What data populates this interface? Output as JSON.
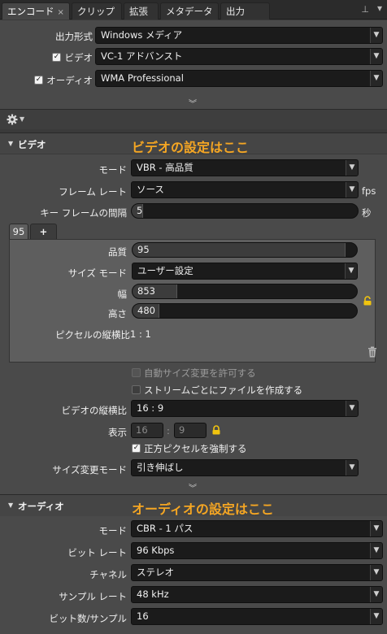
{
  "tabs": [
    {
      "label": "エンコード"
    },
    {
      "label": "クリップ"
    },
    {
      "label": "拡張"
    },
    {
      "label": "メタデータ"
    },
    {
      "label": "出力"
    }
  ],
  "tab_close": "×",
  "pin_glyph": "⊥",
  "menu_glyph": "▾",
  "output": {
    "format_label": "出力形式",
    "format_value": "Windows メディア",
    "video_label": "ビデオ",
    "video_value": "VC-1 アドバンスト",
    "video_checked": true,
    "audio_label": "オーディオ",
    "audio_value": "WMA Professional",
    "audio_checked": true
  },
  "video_section": {
    "title": "ビデオ",
    "annotation": "ビデオの設定はここ",
    "mode_label": "モード",
    "mode_value": "VBR - 高品質",
    "framerate_label": "フレーム レート",
    "framerate_value": "ソース",
    "framerate_unit": "fps",
    "keyframe_label": "キー フレームの間隔",
    "keyframe_value": "5",
    "keyframe_unit": "秒",
    "preset_tabs": [
      "95",
      "+"
    ],
    "quality_label": "品質",
    "quality_value": "95",
    "quality_level": 0.95,
    "size_mode_label": "サイズ モード",
    "size_mode_value": "ユーザー設定",
    "width_label": "幅",
    "width_value": "853",
    "width_level": 0.2,
    "height_label": "高さ",
    "height_value": "480",
    "height_level": 0.12,
    "pixel_aspect_label": "ピクセルの縦横比",
    "pixel_aspect_value": "1 : 1",
    "auto_resize_label": "自動サイズ変更を許可する",
    "per_stream_label": "ストリームごとにファイルを作成する",
    "aspect_label": "ビデオの縦横比",
    "aspect_value": "16 : 9",
    "display_label": "表示",
    "display_w": "16",
    "display_sep": ":",
    "display_h": "9",
    "square_pixel_label": "正方ピクセルを強制する",
    "square_pixel_checked": true,
    "resize_mode_label": "サイズ変更モード",
    "resize_mode_value": "引き伸ばし"
  },
  "audio_section": {
    "title": "オーディオ",
    "annotation": "オーディオの設定はここ",
    "mode_label": "モード",
    "mode_value": "CBR - 1 パス",
    "bitrate_label": "ビット レート",
    "bitrate_value": "96 Kbps",
    "channel_label": "チャネル",
    "channel_value": "ステレオ",
    "samplerate_label": "サンプル レート",
    "samplerate_value": "48 kHz",
    "bits_label": "ビット数/サンプル",
    "bits_value": "16"
  },
  "colors": {
    "annotation": "#f5a623",
    "panel": "#4a4a4a",
    "field": "#1b1b1b"
  },
  "icons": [
    "close-icon",
    "pin-icon",
    "panel-menu-icon",
    "gear-icon",
    "chevron-down-icon",
    "lock-icon",
    "trash-icon",
    "dropdown-arrow-icon",
    "disclosure-triangle-icon"
  ]
}
